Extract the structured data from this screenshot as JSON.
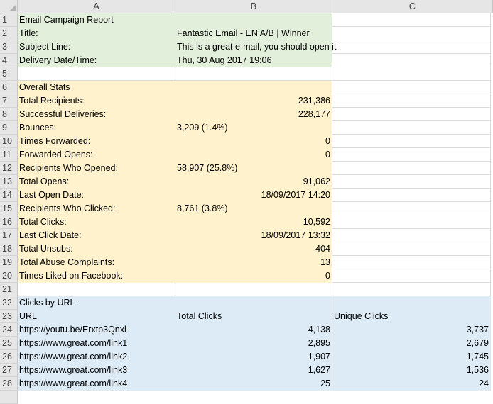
{
  "columns": [
    "A",
    "B",
    "C"
  ],
  "rows": [
    {
      "n": "1",
      "a": "Email Campaign Report",
      "b": "",
      "c": ""
    },
    {
      "n": "2",
      "a": "Title:",
      "b": "Fantastic Email - EN A/B | Winner",
      "c": ""
    },
    {
      "n": "3",
      "a": "Subject Line:",
      "b": "This is a great e-mail, you should open it",
      "c": ""
    },
    {
      "n": "4",
      "a": "Delivery Date/Time:",
      "b": "Thu, 30 Aug 2017 19:06",
      "c": ""
    },
    {
      "n": "5",
      "a": "",
      "b": "",
      "c": ""
    },
    {
      "n": "6",
      "a": "Overall Stats",
      "b": "",
      "c": ""
    },
    {
      "n": "7",
      "a": "Total Recipients:",
      "b": "231,386",
      "c": ""
    },
    {
      "n": "8",
      "a": "Successful Deliveries:",
      "b": "228,177",
      "c": ""
    },
    {
      "n": "9",
      "a": "Bounces:",
      "b": "3,209 (1.4%)",
      "c": ""
    },
    {
      "n": "10",
      "a": "Times Forwarded:",
      "b": "0",
      "c": ""
    },
    {
      "n": "11",
      "a": "Forwarded Opens:",
      "b": "0",
      "c": ""
    },
    {
      "n": "12",
      "a": "Recipients Who Opened:",
      "b": "58,907 (25.8%)",
      "c": ""
    },
    {
      "n": "13",
      "a": "Total Opens:",
      "b": "91,062",
      "c": ""
    },
    {
      "n": "14",
      "a": "Last Open Date:",
      "b": "18/09/2017 14:20",
      "c": ""
    },
    {
      "n": "15",
      "a": "Recipients Who Clicked:",
      "b": "8,761 (3.8%)",
      "c": ""
    },
    {
      "n": "16",
      "a": "Total Clicks:",
      "b": "10,592",
      "c": ""
    },
    {
      "n": "17",
      "a": "Last Click Date:",
      "b": "18/09/2017 13:32",
      "c": ""
    },
    {
      "n": "18",
      "a": "Total Unsubs:",
      "b": "404",
      "c": ""
    },
    {
      "n": "19",
      "a": "Total Abuse Complaints:",
      "b": "13",
      "c": ""
    },
    {
      "n": "20",
      "a": "Times Liked on Facebook:",
      "b": "0",
      "c": ""
    },
    {
      "n": "21",
      "a": "",
      "b": "",
      "c": ""
    },
    {
      "n": "22",
      "a": "Clicks by URL",
      "b": "",
      "c": ""
    },
    {
      "n": "23",
      "a": "URL",
      "b": "Total Clicks",
      "c": "Unique Clicks"
    },
    {
      "n": "24",
      "a": "https://youtu.be/Erxtp3Qnxl",
      "b": "4,138",
      "c": "3,737"
    },
    {
      "n": "25",
      "a": "https://www.great.com/link1",
      "b": "2,895",
      "c": "2,679"
    },
    {
      "n": "26",
      "a": "https://www.great.com/link2",
      "b": "1,907",
      "c": "1,745"
    },
    {
      "n": "27",
      "a": "https://www.great.com/link3",
      "b": "1,627",
      "c": "1,536"
    },
    {
      "n": "28",
      "a": "https://www.great.com/link4",
      "b": "25",
      "c": "24"
    }
  ],
  "colors": {
    "green": "#e2efda",
    "yellow": "#fff2cc",
    "blue": "#ddebf7",
    "header": "#e6e6e6"
  }
}
